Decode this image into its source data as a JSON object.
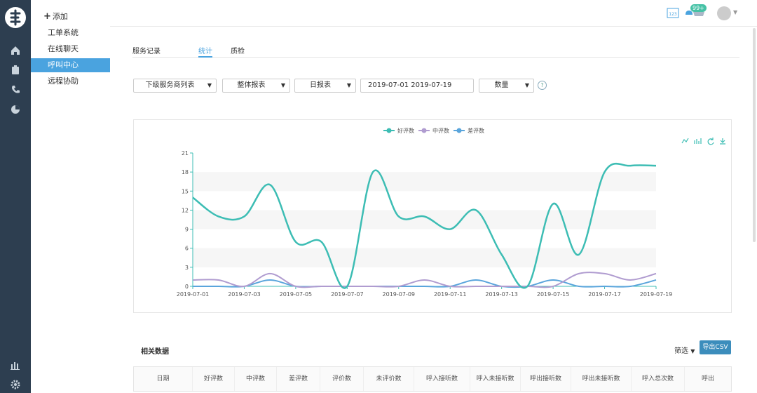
{
  "sidebar": {
    "add_label": "添加",
    "items": [
      "工单系统",
      "在线聊天",
      "呼叫中心",
      "远程协助"
    ],
    "active_index": 2
  },
  "topbar": {
    "calendar_label": "123",
    "notification_badge": "99+"
  },
  "tabs": [
    "服务记录",
    "统计",
    "质检"
  ],
  "active_tab": 1,
  "filters": {
    "provider_list": "下级服务商列表",
    "report_type": "整体报表",
    "period": "日报表",
    "date_range": "2019-07-01 2019-07-19",
    "metric": "数量",
    "help": "?"
  },
  "chart_data": {
    "type": "line",
    "x": [
      "2019-07-01",
      "2019-07-02",
      "2019-07-03",
      "2019-07-04",
      "2019-07-05",
      "2019-07-06",
      "2019-07-07",
      "2019-07-08",
      "2019-07-09",
      "2019-07-10",
      "2019-07-11",
      "2019-07-12",
      "2019-07-13",
      "2019-07-14",
      "2019-07-15",
      "2019-07-16",
      "2019-07-17",
      "2019-07-18",
      "2019-07-19"
    ],
    "xticks": [
      "2019-07-01",
      "2019-07-03",
      "2019-07-05",
      "2019-07-07",
      "2019-07-09",
      "2019-07-11",
      "2019-07-13",
      "2019-07-15",
      "2019-07-17",
      "2019-07-19"
    ],
    "yticks": [
      0,
      3,
      6,
      9,
      12,
      15,
      18,
      21
    ],
    "ylim": [
      0,
      21
    ],
    "legend_position": "top-center",
    "series": [
      {
        "name": "好评数",
        "color": "#3dbdb4",
        "values": [
          14,
          11,
          11,
          16,
          7,
          7,
          0,
          18,
          11,
          11,
          9,
          12,
          5,
          0,
          13,
          5,
          18,
          19,
          19
        ]
      },
      {
        "name": "中评数",
        "color": "#b09cd0",
        "values": [
          1,
          1,
          0,
          2,
          0,
          0,
          0,
          0,
          0,
          1,
          0,
          0,
          0,
          0,
          0,
          2,
          2,
          1,
          2
        ]
      },
      {
        "name": "差评数",
        "color": "#5aa5dc",
        "values": [
          0,
          0,
          0,
          1,
          0,
          0,
          0,
          0,
          0,
          0,
          0,
          1,
          0,
          0,
          1,
          0,
          0,
          0,
          1
        ]
      }
    ]
  },
  "related": {
    "title": "相关数据",
    "filter_label": "筛选",
    "export_label": "导出CSV",
    "columns": [
      "日期",
      "好评数",
      "中评数",
      "差评数",
      "评价数",
      "未评价数",
      "呼入接听数",
      "呼入未接听数",
      "呼出接听数",
      "呼出未接听数",
      "呼入总次数",
      "呼出"
    ]
  }
}
